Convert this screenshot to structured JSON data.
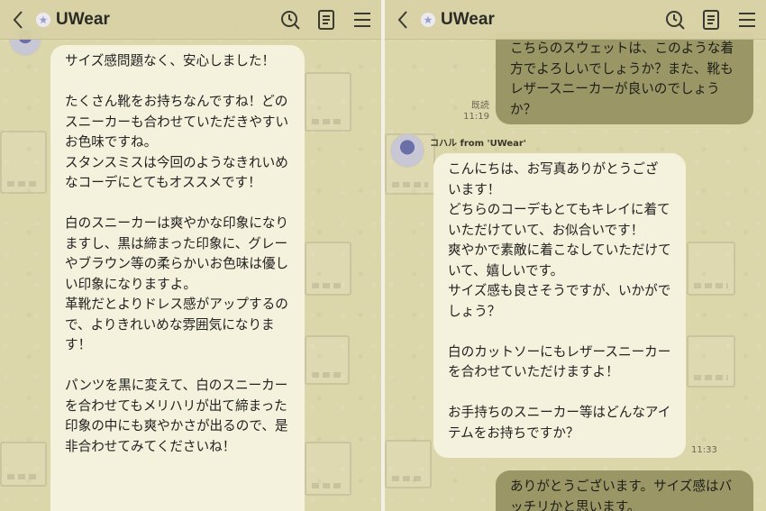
{
  "app": {
    "title": "UWear"
  },
  "icons": {
    "back": "chevron-left-icon",
    "badge": "star-badge-icon",
    "search": "clock-search-icon",
    "notes": "notes-icon",
    "menu": "menu-icon"
  },
  "left": {
    "bubble_text": "サイズ感問題なく、安心しました！\n\nたくさん靴をお持ちなんですね！どのスニーカーも合わせていただきやすいお色味ですね。\nスタンスミスは今回のようなきれいめなコーデにとてもオススメです！\n\n白のスニーカーは爽やかな印象になりますし、黒は締まった印象に、グレーやブラウン等の柔らかいお色味は優しい印象になりますよ。\n革靴だとよりドレス感がアップするので、よりきれいめな雰囲気になります！\n\nパンツを黒に変えて、白のスニーカーを合わせてもメリハリが出て締まった印象の中にも爽やかさが出るので、是非合わせてみてくださいね！"
  },
  "right": {
    "out_top": "こちらのスウェットは、このような着方でよろしいでしょうか？また、靴もレザースニーカーが良いのでしょうか？",
    "read_label": "既読",
    "read_time": "11:19",
    "sender": "コハル from 'UWear'",
    "in_text": "こんにちは、お写真ありがとうございます！\nどちらのコーデもとてもキレイに着ていただけていて、お似合いです！\n爽やかで素敵に着こなしていただけていて、嬉しいです。\nサイズ感も良さそうですが、いかがでしょう？\n\n白のカットソーにもレザースニーカーを合わせていただけますよ！\n\nお手持ちのスニーカー等はどんなアイテムをお持ちですか？",
    "in_time": "11:33",
    "out_bottom": "ありがとうございます。サイズ感はバッチリかと思います。"
  }
}
